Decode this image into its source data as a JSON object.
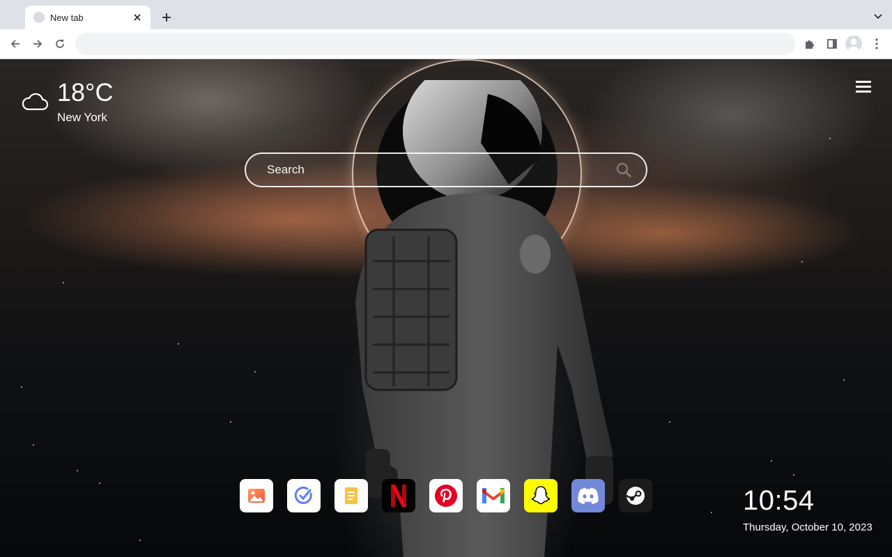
{
  "browser": {
    "tab": {
      "title": "New tab"
    },
    "omnibox": {
      "value": "",
      "placeholder": ""
    }
  },
  "weather": {
    "temperature": "18°C",
    "city": "New York",
    "icon": "cloud-icon"
  },
  "search": {
    "placeholder": "Search"
  },
  "shortcuts": [
    {
      "name": "photos",
      "icon": "image-icon",
      "bg": "#ffffff"
    },
    {
      "name": "tasks",
      "icon": "check-circle-icon",
      "bg": "#ffffff"
    },
    {
      "name": "notes",
      "icon": "notepad-icon",
      "bg": "#ffffff"
    },
    {
      "name": "netflix",
      "icon": "netflix-icon",
      "bg": "#000000"
    },
    {
      "name": "pinterest",
      "icon": "pinterest-icon",
      "bg": "#ffffff"
    },
    {
      "name": "gmail",
      "icon": "gmail-icon",
      "bg": "#ffffff"
    },
    {
      "name": "snapchat",
      "icon": "snapchat-icon",
      "bg": "#fffc00"
    },
    {
      "name": "discord",
      "icon": "discord-icon",
      "bg": "#7289da"
    },
    {
      "name": "steam",
      "icon": "steam-icon",
      "bg": "#1b1b1b"
    }
  ],
  "clock": {
    "time": "10:54",
    "date": "Thursday, October 10, 2023"
  },
  "colors": {
    "tabstrip": "#dee1e6",
    "omnibox": "#f1f3f4"
  }
}
